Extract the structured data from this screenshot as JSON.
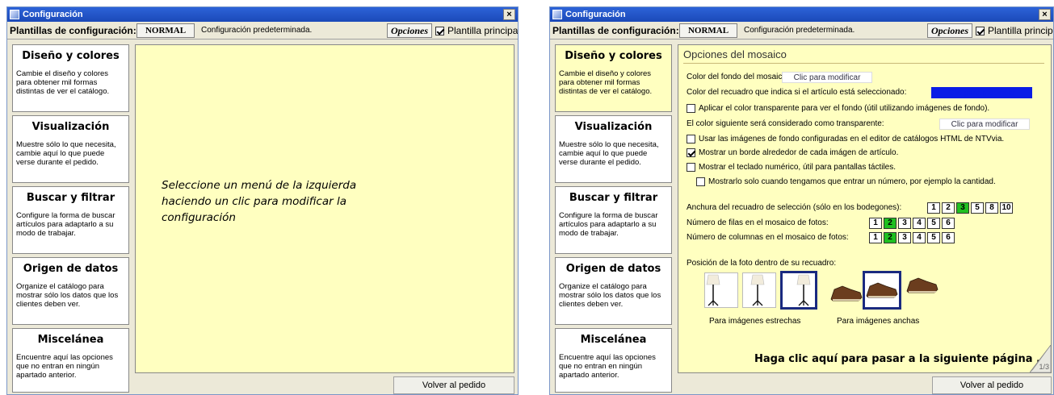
{
  "window": {
    "title": "Configuración",
    "close": "×"
  },
  "toolbar": {
    "templates_label": "Plantillas de configuración:",
    "template_value": "NORMAL",
    "template_desc": "Configuración predeterminada.",
    "options_button": "Opciones",
    "main_template_label": "Plantilla principal",
    "main_template_checked": true
  },
  "menu": [
    {
      "title": "Diseño y colores",
      "desc": "Cambie el diseño y colores para obtener mil formas distintas de ver el catálogo."
    },
    {
      "title": "Visualización",
      "desc": "Muestre sólo lo que necesita, cambie aquí lo que puede verse durante el pedido."
    },
    {
      "title": "Buscar y filtrar",
      "desc": "Configure la forma de buscar artículos para adaptarlo a su modo de trabajar."
    },
    {
      "title": "Origen de datos",
      "desc": "Organize el catálogo para mostrar sólo los datos que los clientes deben ver."
    },
    {
      "title": "Miscelánea",
      "desc": "Encuentre aquí las opciones que no entran en ningún apartado anterior."
    }
  ],
  "placeholder": "Seleccione un menú de la izquierda haciendo un clic para modificar la configuración",
  "back_button": "Volver al pedido",
  "mosaic": {
    "title": "Opciones del mosaico",
    "bg_color_label": "Color del fondo del mosaico:",
    "bg_color_button": "Clic para modificar",
    "frame_color_label": "Color del recuadro que indica si el artículo está seleccionado:",
    "frame_color_button": "Clic para modificar",
    "frame_color_hex": "#0a1de6",
    "transparent_check": "Aplicar el color transparente para ver el fondo (útil utilizando imágenes de fondo).",
    "transparent_color_label": "El color siguiente será considerado como transparente:",
    "transparent_color_button": "Clic para modificar",
    "bg_images_check": "Usar las imágenes de fondo configuradas en el editor de catálogos HTML de NTVvia.",
    "border_check": "Mostrar un borde alrededor de cada imágen de artículo.",
    "keypad_check": "Mostrar el teclado numérico, útil para pantallas táctiles.",
    "keypad_sub_check": "Mostrarlo solo cuando tengamos que entrar un número, por ejemplo la cantidad.",
    "frame_width_label": "Anchura del recuadro de selección (sólo en los bodegones):",
    "frame_width_options": [
      "1",
      "2",
      "3",
      "5",
      "8",
      "10"
    ],
    "frame_width_selected": "3",
    "rows_label": "Número de filas en el mosaico de fotos:",
    "rows_options": [
      "1",
      "2",
      "3",
      "4",
      "5",
      "6"
    ],
    "rows_selected": "2",
    "cols_label": "Número de columnas en el mosaico de fotos:",
    "cols_options": [
      "1",
      "2",
      "3",
      "4",
      "5",
      "6"
    ],
    "cols_selected": "2",
    "position_label": "Posición de la foto dentro de su recuadro:",
    "narrow_caption": "Para imágenes estrechas",
    "wide_caption": "Para imágenes anchas",
    "next_page": "Haga clic aquí para pasar a la siguiente página ...",
    "page_indicator": "1/3"
  }
}
